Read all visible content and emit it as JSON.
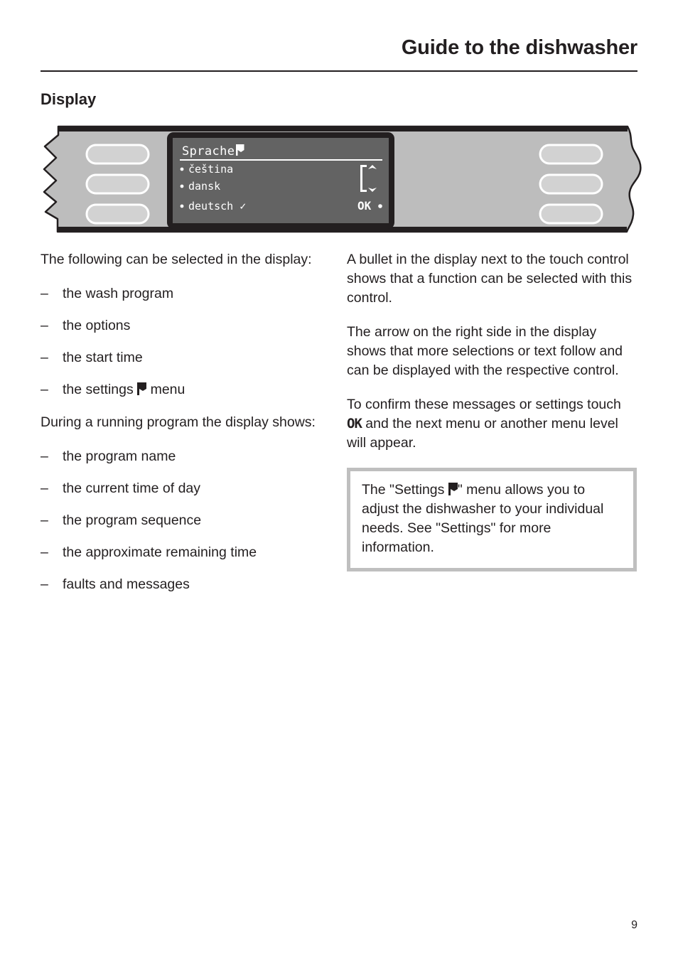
{
  "header": {
    "title": "Guide to the dishwasher"
  },
  "section": {
    "heading": "Display"
  },
  "panel": {
    "icon_names": {
      "left_controls": "touch-control-left",
      "right_controls": "touch-control-right",
      "display": "lcd-display"
    },
    "display": {
      "title": "Sprache",
      "title_icon": "flag-icon",
      "items": [
        {
          "bullet": "•",
          "label": "čeština",
          "check": ""
        },
        {
          "bullet": "•",
          "label": "dansk",
          "check": ""
        },
        {
          "bullet": "•",
          "label": "deutsch",
          "check": "✓"
        }
      ],
      "scroll_up_icon": "chevron-up-icon",
      "scroll_down_icon": "chevron-down-icon",
      "scrollbar_icon": "scrollbar-track",
      "ok_label": "OK",
      "ok_bullet": "•"
    },
    "colors": {
      "panel_face": "#bdbdbd",
      "panel_outline": "#231f20",
      "touch_control": "#d2d2d2",
      "touch_control_border": "#ffffff",
      "lcd_bezel": "#231f20",
      "lcd_screen": "#636363",
      "lcd_text": "#ffffff"
    }
  },
  "left_column": {
    "intro": "The following can be selected in the display:",
    "list1_dash": "–",
    "list1": [
      {
        "text": "the wash program"
      },
      {
        "text": "the options"
      },
      {
        "text": "the start time"
      },
      {
        "text_before": "the settings ",
        "icon": "flag-icon",
        "text_after": " menu"
      }
    ],
    "intro2": "During a running program the display shows:",
    "list2_dash": "–",
    "list2": [
      {
        "text": "the program name"
      },
      {
        "text": "the current time of day"
      },
      {
        "text": "the program sequence"
      },
      {
        "text": "the approximate remaining time"
      },
      {
        "text": "faults and messages"
      }
    ]
  },
  "right_column": {
    "para1": "A bullet in the display next to the touch control shows that a function can be selected with this control.",
    "para2": "The arrow on the right side in the display shows that more selections or text follow and can be displayed with the respective control.",
    "para3_before": "To confirm these messages or settings touch ",
    "para3_ok": "OK",
    "para3_after": " and the next menu or another menu level will appear.",
    "note_before": "The \"Settings ",
    "note_icon": "flag-icon",
    "note_after": "\" menu allows you to adjust the dishwasher to your individual needs. See \"Settings\" for more information."
  },
  "footer": {
    "page_number": "9"
  }
}
